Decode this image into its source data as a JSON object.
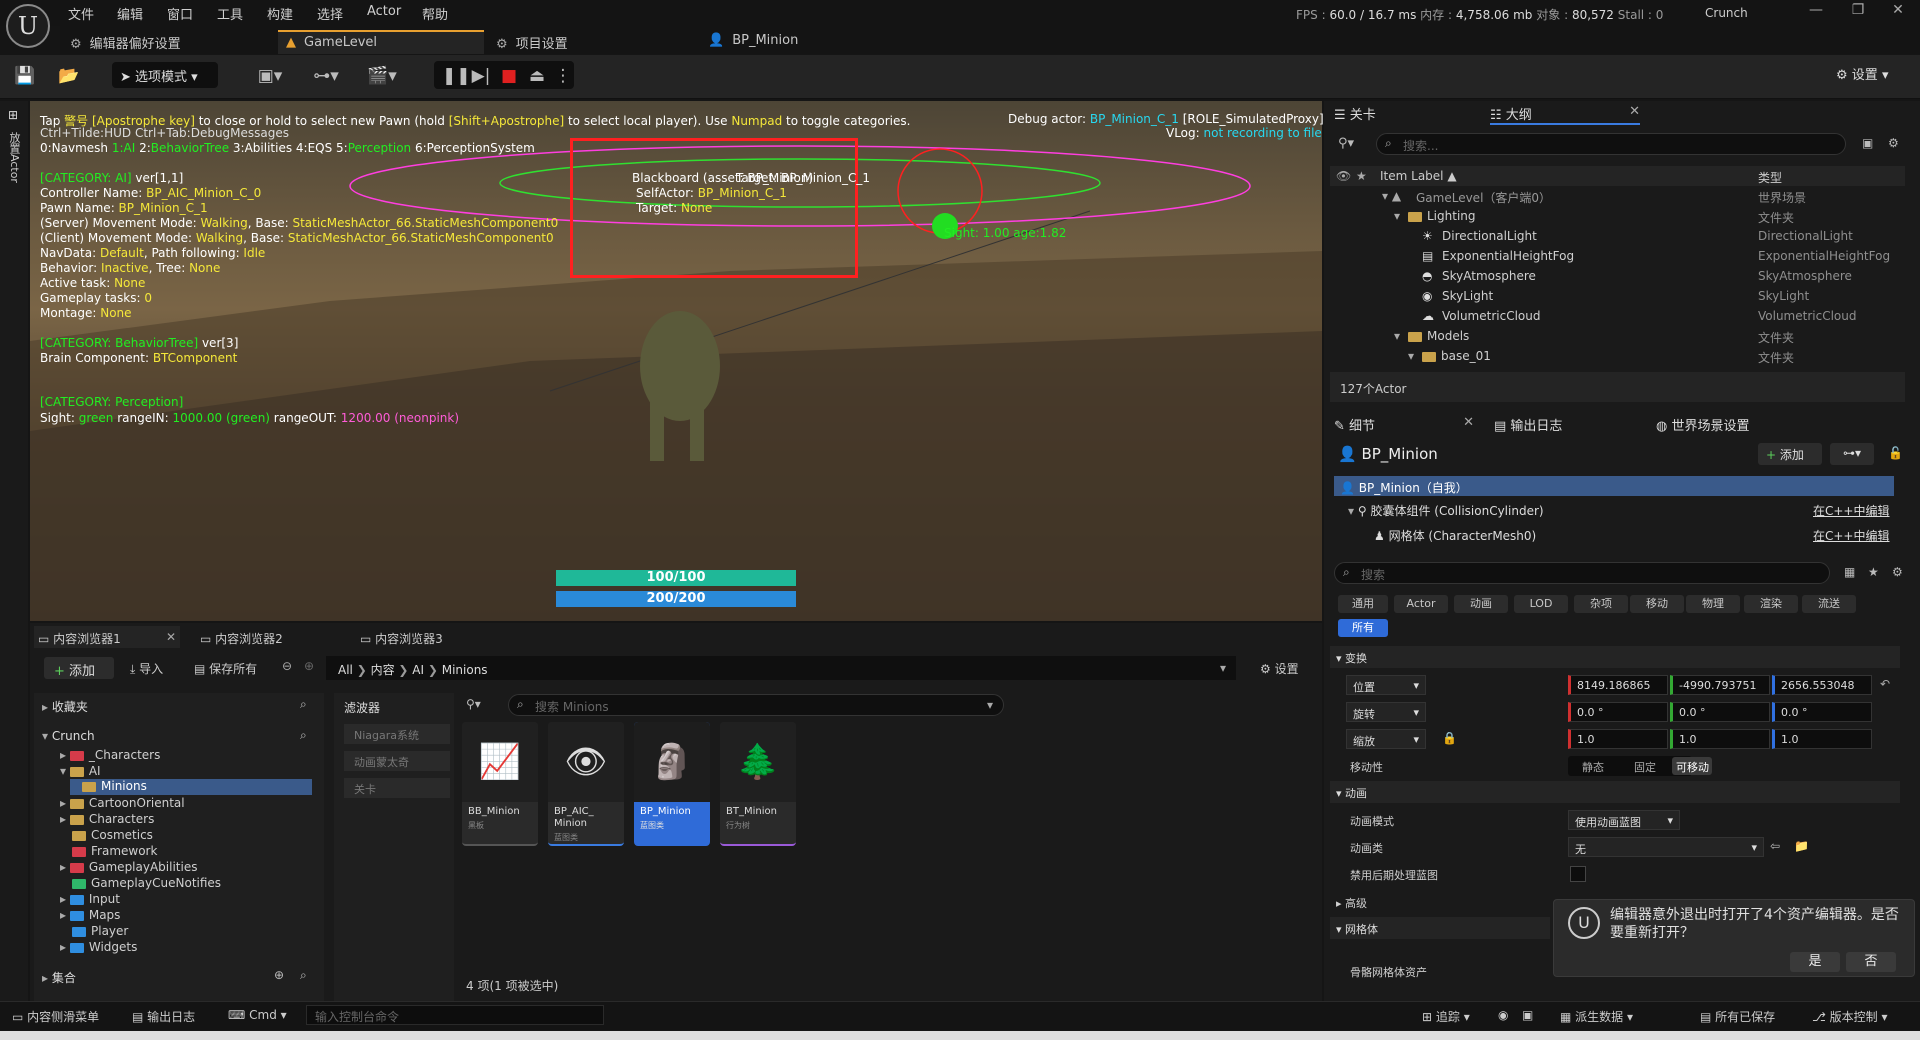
{
  "menu": [
    "文件",
    "编辑",
    "窗口",
    "工具",
    "构建",
    "选择",
    "Actor",
    "帮助"
  ],
  "stats": {
    "fps_label": "FPS :",
    "fps": "60.0",
    "ms": "/ 16.7 ms",
    "mem_label": "内存 :",
    "mem": "4,758.06 mb",
    "obj_label": "对象 :",
    "obj": "80,572",
    "stall": "Stall : 0",
    "project": "Crunch"
  },
  "tabs": {
    "prefs": "编辑器偏好设置",
    "level": "GameLevel",
    "project": "项目设置",
    "bp": "BP_Minion"
  },
  "toolbar": {
    "mode": "选项模式",
    "settings": "设置"
  },
  "viewport": {
    "l1a": "Tap ",
    "l1b": "警号 [Apostrophe key]",
    "l1c": " to close or hold to select new Pawn (hold ",
    "l1d": "[Shift+Apostrophe]",
    "l1e": " to select local player). Use ",
    "l1f": "Numpad",
    "l1g": " to toggle categories.",
    "l2": "Ctrl+Tilde:HUD  Ctrl+Tab:DebugMessages",
    "l3a": "0:Navmesh ",
    "l3b": "1:AI",
    "l3c": " 2:",
    "l3d": "BehaviorTree",
    "l3e": " 3:Abilities  4:EQS  5:",
    "l3f": "Perception",
    "l3g": "  6:PerceptionSystem",
    "debug_a": "Debug actor: ",
    "debug_b": "BP_Minion_C_1",
    "debug_c": " [ROLE_SimulatedProxy]",
    "vlog_a": "VLog: ",
    "vlog_b": "not recording to file",
    "ai_cat": "[CATEGORY: AI]",
    "ai_ver": " ver[1,1]",
    "ctrl_a": "Controller Name: ",
    "ctrl_b": "BP_AIC_Minion_C_0",
    "pawn_a": "Pawn Name: ",
    "pawn_b": "BP_Minion_C_1",
    "srv_a": "(Server) Movement Mode: ",
    "srv_b": "Walking",
    "srv_c": ", Base: ",
    "srv_d": "StaticMeshActor_66.StaticMeshComponent0",
    "cli_a": "(Client) Movement Mode: ",
    "cli_b": "Walking",
    "cli_c": ", Base: ",
    "cli_d": "StaticMeshActor_66.StaticMeshComponent0",
    "nav_a": "NavData: ",
    "nav_b": "Default",
    "nav_c": ", Path following: ",
    "nav_d": "Idle",
    "beh_a": "Behavior: ",
    "beh_b": "Inactive",
    "beh_c": ", Tree: ",
    "beh_d": "None",
    "task_a": "Active task: ",
    "task_b": "None",
    "gp_a": "Gameplay tasks: ",
    "gp_b": "0",
    "mont_a": "Montage: ",
    "mont_b": "None",
    "bt_cat": "[CATEGORY: BehaviorTree]",
    "bt_ver": " ver[3]",
    "brain_a": "Brain Component: ",
    "brain_b": "BTComponent",
    "perc_cat": "[CATEGORY: Perception]",
    "sight_a": "Sight: ",
    "sight_b": "green",
    "sight_c": " rangeIN: ",
    "sight_d": "1000.00 (green)",
    "sight_e": "  rangeOUT: ",
    "sight_f": "1200.00 (neonpink)",
    "bb1": "Blackboard (asset: BP_Minion)",
    "bb1b": "Target: BP_Minion_C_1",
    "self_a": "SelfActor: ",
    "self_b": "BP_Minion_C_1",
    "tgt_a": "Target: ",
    "tgt_b": "None",
    "sight_age": "Sight: 1.00 age:1.82",
    "hp": "100/100",
    "mp": "200/200"
  },
  "left_strip": "放置Actor",
  "outliner": {
    "tab1": "关卡",
    "tab2": "大纲",
    "search": "搜索...",
    "col_label": "Item Label ▲",
    "col_type": "类型",
    "rows": [
      {
        "label": "GameLevel（客户端0）",
        "type": "世界场景"
      },
      {
        "label": "Lighting",
        "type": "文件夹"
      },
      {
        "label": "DirectionalLight",
        "type": "DirectionalLight"
      },
      {
        "label": "ExponentialHeightFog",
        "type": "ExponentialHeightFog"
      },
      {
        "label": "SkyAtmosphere",
        "type": "SkyAtmosphere"
      },
      {
        "label": "SkyLight",
        "type": "SkyLight"
      },
      {
        "label": "VolumetricCloud",
        "type": "VolumetricCloud"
      },
      {
        "label": "Models",
        "type": "文件夹"
      },
      {
        "label": "base_01",
        "type": "文件夹"
      }
    ],
    "count": "127个Actor"
  },
  "details": {
    "tab1": "细节",
    "tab2": "输出日志",
    "tab3": "世界场景设置",
    "title": "BP_Minion",
    "add": "添加",
    "self": "BP_Minion（自我）",
    "comp1": "胶囊体组件 (CollisionCylinder)",
    "comp2": "网格体 (CharacterMesh0)",
    "edit_cpp": "在C++中编辑",
    "search": "搜索",
    "cats": [
      "通用",
      "Actor",
      "动画",
      "LOD",
      "杂项",
      "移动",
      "物理",
      "渲染",
      "流送"
    ],
    "all": "所有",
    "transform": "变换",
    "loc": "位置",
    "rot": "旋转",
    "scale": "缩放",
    "mobility": "移动性",
    "loc_x": "8149.186865",
    "loc_y": "-4990.793751",
    "loc_z": "2656.553048",
    "rot_x": "0.0 °",
    "rot_y": "0.0 °",
    "rot_z": "0.0 °",
    "sc_x": "1.0",
    "sc_y": "1.0",
    "sc_z": "1.0",
    "mob_static": "静态",
    "mob_fixed": "固定",
    "mob_movable": "可移动",
    "anim": "动画",
    "anim_mode": "动画模式",
    "anim_mode_val": "使用动画蓝图",
    "anim_class": "动画类",
    "anim_class_val": "无",
    "disable_post": "禁用后期处理蓝图",
    "advanced": "高级",
    "mesh": "网格体",
    "skel_mesh": "骨骼网格体资产"
  },
  "toast": {
    "text": "编辑器意外退出时打开了4个资产编辑器。是否要重新打开？",
    "yes": "是",
    "no": "否"
  },
  "content_browser": {
    "tab1": "内容浏览器1",
    "tab2": "内容浏览器2",
    "tab3": "内容浏览器3",
    "add": "添加",
    "import": "导入",
    "save_all": "保存所有",
    "path": [
      "All",
      "内容",
      "AI",
      "Minions"
    ],
    "settings": "设置",
    "favorites": "收藏夹",
    "project": "Crunch",
    "collections": "集合",
    "tree": [
      {
        "label": "_Characters",
        "color": "red"
      },
      {
        "label": "AI",
        "color": "yellow"
      },
      {
        "label": "Minions",
        "color": "yellow"
      },
      {
        "label": "CartoonOriental",
        "color": "yellow"
      },
      {
        "label": "Characters",
        "color": "yellow"
      },
      {
        "label": "Cosmetics",
        "color": "yellow"
      },
      {
        "label": "Framework",
        "color": "red"
      },
      {
        "label": "GameplayAbilities",
        "color": "red"
      },
      {
        "label": "GameplayCueNotifies",
        "color": "green"
      },
      {
        "label": "Input",
        "color": "blue"
      },
      {
        "label": "Maps",
        "color": "blue"
      },
      {
        "label": "Player",
        "color": "blue"
      },
      {
        "label": "Widgets",
        "color": "blue"
      }
    ],
    "filters": "滤波器",
    "filter_items": [
      "Niagara系统",
      "动画蒙太奇",
      "关卡"
    ],
    "search": "搜索 Minions",
    "assets": [
      {
        "name": "BB_Minion",
        "sub": "黑板",
        "icon": "📈"
      },
      {
        "name": "BP_AIC_\nMinion",
        "sub": "蓝图类",
        "icon": "👁"
      },
      {
        "name": "BP_Minion",
        "sub": "蓝图类",
        "icon": "🗿"
      },
      {
        "name": "BT_Minion",
        "sub": "行为树",
        "icon": "🌲"
      }
    ],
    "count": "4 项(1 项被选中)"
  },
  "status": {
    "drawer": "内容侧滑菜单",
    "log": "输出日志",
    "cmd": "Cmd",
    "console": "输入控制台命令",
    "trace": "追踪",
    "derived": "派生数据",
    "saved": "所有已保存",
    "vcs": "版本控制"
  }
}
